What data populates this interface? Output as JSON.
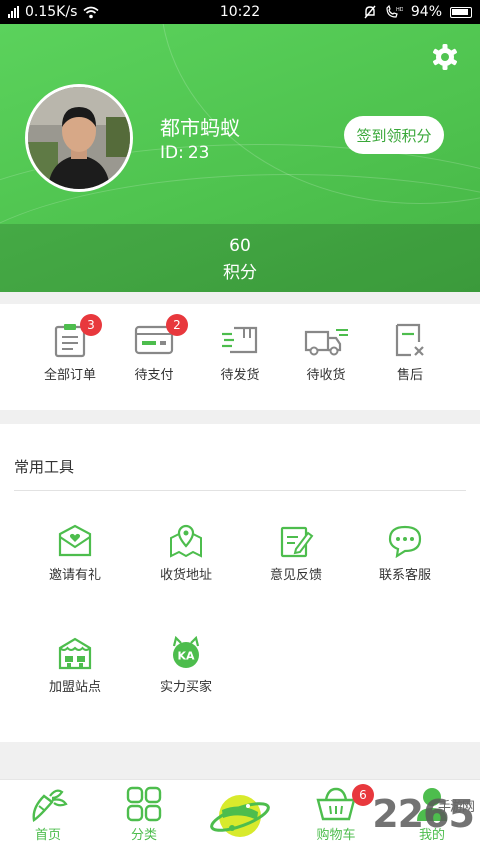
{
  "status_bar": {
    "network_speed": "0.15K/s",
    "time": "10:22",
    "battery": "94%"
  },
  "profile": {
    "name": "都市蚂蚁",
    "id_label": "ID:",
    "id_value": "23",
    "signin_label": "签到领积分",
    "points_value": "60",
    "points_label": "积分"
  },
  "orders": [
    {
      "label": "全部订单",
      "icon": "clipboard-icon",
      "badge": "3"
    },
    {
      "label": "待支付",
      "icon": "card-icon",
      "badge": "2"
    },
    {
      "label": "待发货",
      "icon": "box-icon",
      "badge": ""
    },
    {
      "label": "待收货",
      "icon": "truck-icon",
      "badge": ""
    },
    {
      "label": "售后",
      "icon": "return-doc-icon",
      "badge": ""
    }
  ],
  "tools": {
    "title": "常用工具",
    "items": [
      {
        "label": "邀请有礼",
        "icon": "heart-envelope-icon"
      },
      {
        "label": "收货地址",
        "icon": "map-pin-icon"
      },
      {
        "label": "意见反馈",
        "icon": "edit-note-icon"
      },
      {
        "label": "联系客服",
        "icon": "chat-icon"
      },
      {
        "label": "加盟站点",
        "icon": "store-icon"
      },
      {
        "label": "实力买家",
        "icon": "ka-badge-icon",
        "icon_text": "KA"
      }
    ]
  },
  "tabbar": [
    {
      "label": "首页",
      "icon": "carrot-icon"
    },
    {
      "label": "分类",
      "icon": "grid-icon"
    },
    {
      "label": "",
      "icon": "planet-icon"
    },
    {
      "label": "购物车",
      "icon": "basket-icon",
      "badge": "6"
    },
    {
      "label": "我的",
      "icon": "user-icon"
    }
  ],
  "watermark": {
    "text": "2265",
    "sub": "手游网"
  },
  "colors": {
    "accent": "#4dbd4d",
    "header": "#52c452",
    "badge": "#e8383d"
  }
}
